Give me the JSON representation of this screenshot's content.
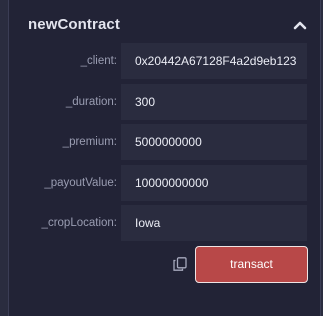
{
  "function": {
    "name": "newContract"
  },
  "params": [
    {
      "label": "_client:",
      "value": "0x20442A67128F4a2d9eb123"
    },
    {
      "label": "_duration:",
      "value": "300"
    },
    {
      "label": "_premium:",
      "value": "5000000000"
    },
    {
      "label": "_payoutValue:",
      "value": "10000000000"
    },
    {
      "label": "_cropLocation:",
      "value": "Iowa"
    }
  ],
  "actions": {
    "transact_label": "transact",
    "collapse_icon": "chevron-up-icon",
    "copy_icon": "copy-icon"
  },
  "colors": {
    "panel_bg": "#222336",
    "input_bg": "#2a2c3f",
    "transact_bg": "#b84848"
  }
}
